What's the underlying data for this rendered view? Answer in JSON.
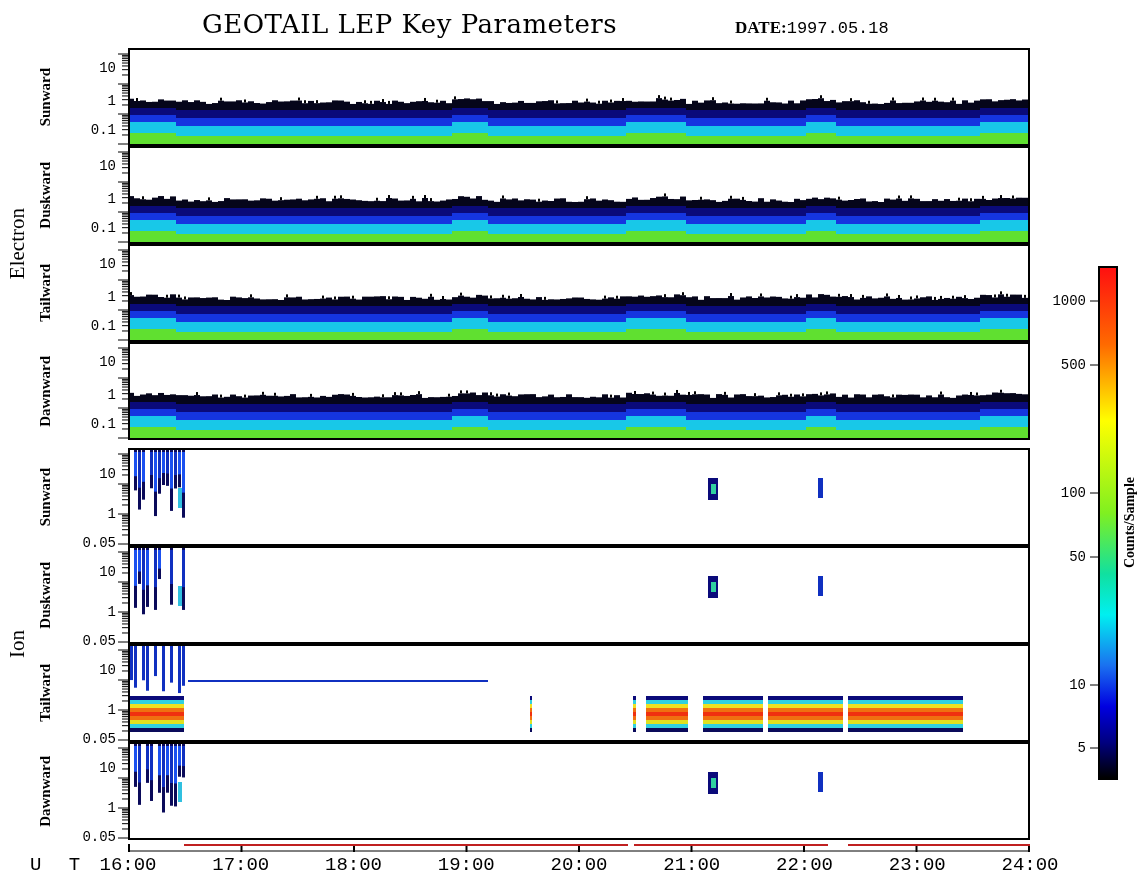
{
  "title": "GEOTAIL LEP Key Parameters",
  "date_label": "DATE:",
  "date": "1997.05.18",
  "groups": [
    {
      "label": "Electron",
      "panels": [
        {
          "label": "Sunward",
          "kind": "electron",
          "yticks": [
            "10",
            "1",
            "0.1"
          ]
        },
        {
          "label": "Duskward",
          "kind": "electron",
          "yticks": [
            "10",
            "1",
            "0.1"
          ]
        },
        {
          "label": "Tailward",
          "kind": "electron",
          "yticks": [
            "10",
            "1",
            "0.1"
          ]
        },
        {
          "label": "Dawnward",
          "kind": "electron",
          "yticks": [
            "10",
            "1",
            "0.1"
          ]
        }
      ]
    },
    {
      "label": "Ion",
      "panels": [
        {
          "label": "Sunward",
          "kind": "ion",
          "yticks": [
            "10",
            "1",
            "0.05"
          ]
        },
        {
          "label": "Duskward",
          "kind": "ion",
          "yticks": [
            "10",
            "1",
            "0.05"
          ]
        },
        {
          "label": "Tailward",
          "kind": "ion-beam",
          "yticks": [
            "10",
            "1",
            "0.05"
          ]
        },
        {
          "label": "Dawnward",
          "kind": "ion",
          "yticks": [
            "10",
            "1",
            "0.05"
          ]
        }
      ]
    }
  ],
  "xaxis": {
    "label": "U T",
    "ticks": [
      "16:00",
      "17:00",
      "18:00",
      "19:00",
      "20:00",
      "21:00",
      "22:00",
      "23:00",
      "24:00"
    ]
  },
  "colorbar": {
    "label": "Counts/Sample",
    "ticks": [
      "1000",
      "500",
      "100",
      "50",
      "10",
      "5"
    ]
  }
}
